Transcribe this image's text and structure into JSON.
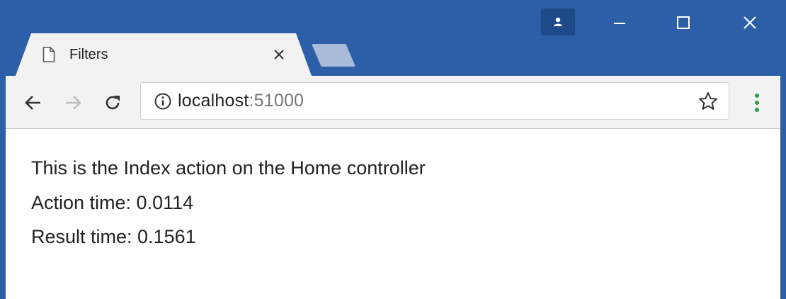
{
  "tab": {
    "title": "Filters",
    "page_icon": "page-icon",
    "close_icon": "close-icon"
  },
  "window_controls": [
    "profile-icon",
    "minimize-icon",
    "maximize-icon",
    "close-window-icon"
  ],
  "toolbar": {
    "icons": [
      "back-arrow-icon",
      "forward-arrow-icon",
      "reload-icon",
      "info-icon",
      "star-icon",
      "menu-dots-icon"
    ],
    "url_host": "localhost",
    "url_port": ":51000"
  },
  "page": {
    "heading": "This is the Index action on the Home controller",
    "action_time": "Action time: 0.0114",
    "result_time": "Result time: 0.1561"
  },
  "colors": {
    "frame": "#2d5fa9",
    "toolbar": "#f2f2f2",
    "menu_dots": "#2e9e47",
    "profile_button": "#1f4a8a"
  }
}
